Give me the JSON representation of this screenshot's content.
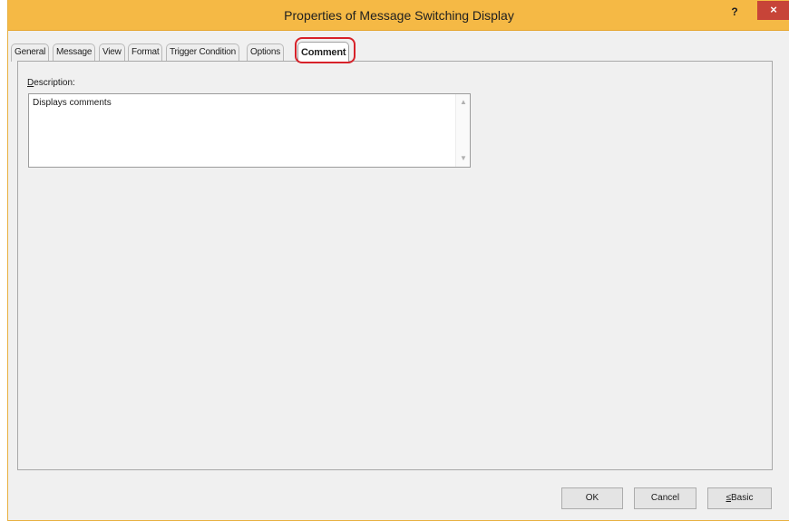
{
  "window": {
    "title": "Properties of Message Switching Display",
    "help_label": "?",
    "close_label": "×"
  },
  "tabs": [
    {
      "label": "General",
      "active": false
    },
    {
      "label": "Message",
      "active": false
    },
    {
      "label": "View",
      "active": false
    },
    {
      "label": "Format",
      "active": false
    },
    {
      "label": "Trigger Condition",
      "active": false
    },
    {
      "label": "Options",
      "active": false
    },
    {
      "label": "Comment",
      "active": true
    }
  ],
  "comment_tab": {
    "description_label_underlined": "D",
    "description_label_rest": "escription:",
    "description_value": "Displays comments"
  },
  "buttons": {
    "ok_label": "OK",
    "cancel_label": "Cancel",
    "basic_label_prefix": "≤",
    "basic_label_rest": "Basic"
  },
  "colors": {
    "titlebar": "#f5b945",
    "close_button": "#c74438",
    "highlight": "#d7222a"
  }
}
